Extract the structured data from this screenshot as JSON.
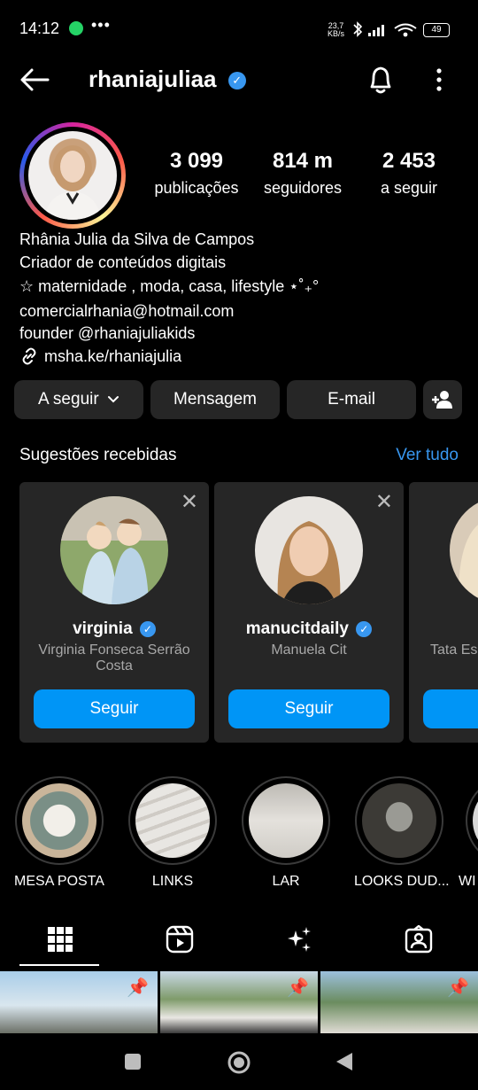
{
  "status_bar": {
    "time": "14:12",
    "dots": "•••",
    "net_speed_value": "23,7",
    "net_speed_unit": "KB/s",
    "battery": "49"
  },
  "header": {
    "username": "rhaniajuliaa",
    "verified_mark": "✓"
  },
  "stats": {
    "posts": {
      "value": "3 099",
      "label": "publicações"
    },
    "followers": {
      "value": "814 m",
      "label": "seguidores"
    },
    "following": {
      "value": "2 453",
      "label": "a seguir"
    }
  },
  "bio": {
    "name": "Rhânia Julia da Silva de Campos",
    "category": "Criador de conteúdos digitais",
    "line1": "☆ maternidade , moda, casa, lifestyle  ⋆˚₊°",
    "email": "comercialrhania@hotmail.com",
    "founder": "founder @rhaniajuliakids",
    "link": "msha.ke/rhaniajulia"
  },
  "actions": {
    "following": "A seguir",
    "message": "Mensagem",
    "email": "E-mail"
  },
  "suggestions": {
    "title": "Sugestões recebidas",
    "see_all": "Ver tudo",
    "cards": [
      {
        "username": "virginia",
        "full_name": "Virginia Fonseca Serrão Costa",
        "button": "Seguir"
      },
      {
        "username": "manucitdaily",
        "full_name": "Manuela Cit",
        "button": "Seguir"
      },
      {
        "full_name": "Tata Es"
      }
    ]
  },
  "highlights": [
    {
      "label": "MESA POSTA"
    },
    {
      "label": "LINKS"
    },
    {
      "label": "LAR"
    },
    {
      "label": "LOOKS DUD..."
    },
    {
      "label": "WI"
    }
  ],
  "icons": {
    "back": "arrow-left-icon",
    "bell": "bell-icon",
    "more": "more-vertical-icon",
    "add_person": "add-person-icon",
    "grid": "grid-icon",
    "reels": "reels-icon",
    "sparkles": "sparkles-icon",
    "tagged": "tagged-icon",
    "pin": "pin-icon"
  },
  "colors": {
    "accent": "#3897f0",
    "follow_button": "#0095f6",
    "button_bg": "#262626",
    "background": "#000000"
  }
}
